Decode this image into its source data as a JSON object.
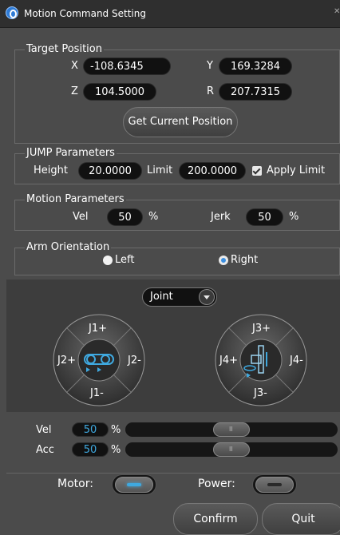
{
  "window": {
    "title": "Motion Command Setting"
  },
  "target_position": {
    "title": "Target Position",
    "x": {
      "label": "X",
      "value": "-108.6345"
    },
    "y": {
      "label": "Y",
      "value": "169.3284"
    },
    "z": {
      "label": "Z",
      "value": "104.5000"
    },
    "r": {
      "label": "R",
      "value": "207.7315"
    },
    "get_current_label": "Get Current Position"
  },
  "jump": {
    "title": "JUMP Parameters",
    "height_label": "Height",
    "height_value": "20.0000",
    "limit_label": "Limit",
    "limit_value": "200.0000",
    "apply_limit_label": "Apply Limit",
    "apply_limit_checked": true
  },
  "motion": {
    "title": "Motion Parameters",
    "vel_label": "Vel",
    "vel_value": "50",
    "vel_unit": "%",
    "jerk_label": "Jerk",
    "jerk_value": "50",
    "jerk_unit": "%"
  },
  "arm": {
    "title": "Arm Orientation",
    "left_label": "Left",
    "right_label": "Right",
    "selected": "Right"
  },
  "jog": {
    "mode": "Joint",
    "pad1": {
      "up": "J1+",
      "down": "J1-",
      "left": "J2+",
      "right": "J2-"
    },
    "pad2": {
      "up": "J3+",
      "down": "J3-",
      "left": "J4+",
      "right": "J4-"
    }
  },
  "speed": {
    "vel_label": "Vel",
    "vel_value": "50",
    "acc_label": "Acc",
    "acc_value": "50",
    "unit": "%",
    "vel_fraction": 0.5,
    "acc_fraction": 0.5
  },
  "toggles": {
    "motor_label": "Motor:",
    "power_label": "Power:",
    "motor_on": true,
    "power_on": false
  },
  "buttons": {
    "confirm": "Confirm",
    "quit": "Quit"
  },
  "colors": {
    "accent": "#3fa9e0",
    "background": "#4b4b4b",
    "panel": "#3d3d3d"
  }
}
